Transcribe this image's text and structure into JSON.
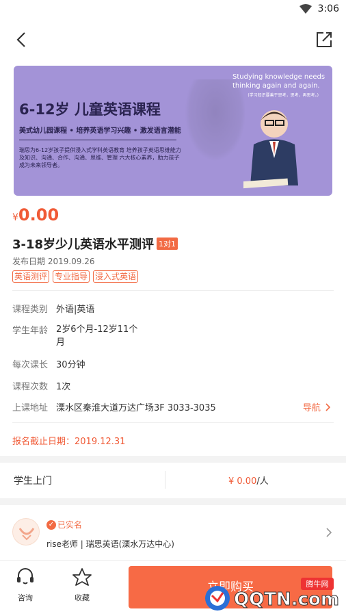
{
  "status": {
    "time": "3:06"
  },
  "banner": {
    "title": "6-12岁 儿童英语课程",
    "subtitle": "美式幼儿园课程 • 培养英语学习兴趣 • 激发语言潜能",
    "desc": "瑞思为6-12岁孩子提供浸入式学科英语教育 培养孩子英语思维能力及知识、沟通、合作、沟通、思维、管理 六大核心素养，助力孩子成为未来领导者。",
    "english": "Studying knowledge needs thinking again and again.",
    "english_small": "(学习知识要善于思考，思考，再思考。)"
  },
  "price": {
    "currency": "¥",
    "value": "0.00"
  },
  "course": {
    "title": "3-18岁少儿英语水平测评",
    "badge": "1对1",
    "publish_date": "发布日期 2019.09.26",
    "tags": [
      "英语测评",
      "专业指导",
      "浸入式英语"
    ]
  },
  "info": {
    "category_label": "课程类别",
    "category": "外语|英语",
    "age_label": "学生年龄",
    "age_line1": "2岁6个月-12岁11个",
    "age_line2": "月",
    "duration_label": "每次课长",
    "duration": "30分钟",
    "times_label": "课程次数",
    "times": "1次",
    "address_label": "上课地址",
    "address": "溧水区秦淮大道万达广场3F 3033-3035",
    "nav_label": "导航"
  },
  "deadline": "报名截止日期：2019.12.31",
  "service": {
    "name": "学生上门",
    "price": "¥ 0.00",
    "unit": "/人"
  },
  "teacher": {
    "verified": "已实名",
    "name": "rise老师 | 瑞思英语(溧水万达中心)"
  },
  "bottom": {
    "consult": "咨询",
    "favorite": "收藏",
    "buy": "立即购买"
  },
  "watermark": {
    "text": "QQTN.com",
    "badge": "腾牛网"
  },
  "colors": {
    "accent": "#f26a43",
    "price": "#f05a36",
    "banner": "#a393d7"
  }
}
